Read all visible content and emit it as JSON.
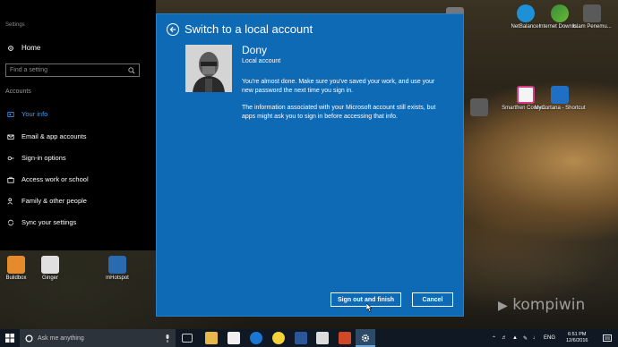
{
  "settings_window": {
    "title": "Settings",
    "home_label": "Home",
    "search_placeholder": "Find a setting",
    "section_label": "Accounts",
    "nav_items": [
      {
        "label": "Your info",
        "active": true
      },
      {
        "label": "Email & app accounts"
      },
      {
        "label": "Sign-in options"
      },
      {
        "label": "Access work or school"
      },
      {
        "label": "Family & other people"
      },
      {
        "label": "Sync your settings"
      }
    ]
  },
  "dialog": {
    "title": "Switch to a local account",
    "user_name": "Dony",
    "account_type": "Local account",
    "message_1": "You're almost done. Make sure you've saved your work, and use your new password the next time you sign in.",
    "message_2": "The information associated with your Microsoft account still exists, but apps might ask you to sign in before accessing that info.",
    "primary_button": "Sign out and finish",
    "cancel_button": "Cancel"
  },
  "desktop_icons": [
    {
      "label": "NetBalancer"
    },
    {
      "label": "Internet Downlo..."
    },
    {
      "label": "Islam Penemu..."
    },
    {
      "label": "Smartfren Connex..."
    },
    {
      "label": "MyCortana - Shortcut"
    },
    {
      "label": "Buildbox"
    },
    {
      "label": "Ginger"
    },
    {
      "label": "mHotspot"
    }
  ],
  "taskbar": {
    "search_placeholder": "Ask me anything",
    "language": "ENG",
    "time": "6:51 PM",
    "date": "12/6/2016"
  },
  "watermark": "kompiwin",
  "colors": {
    "dialog_bg": "#0f6ab6",
    "accent": "#3aa0ff",
    "taskbar": "#101923"
  }
}
